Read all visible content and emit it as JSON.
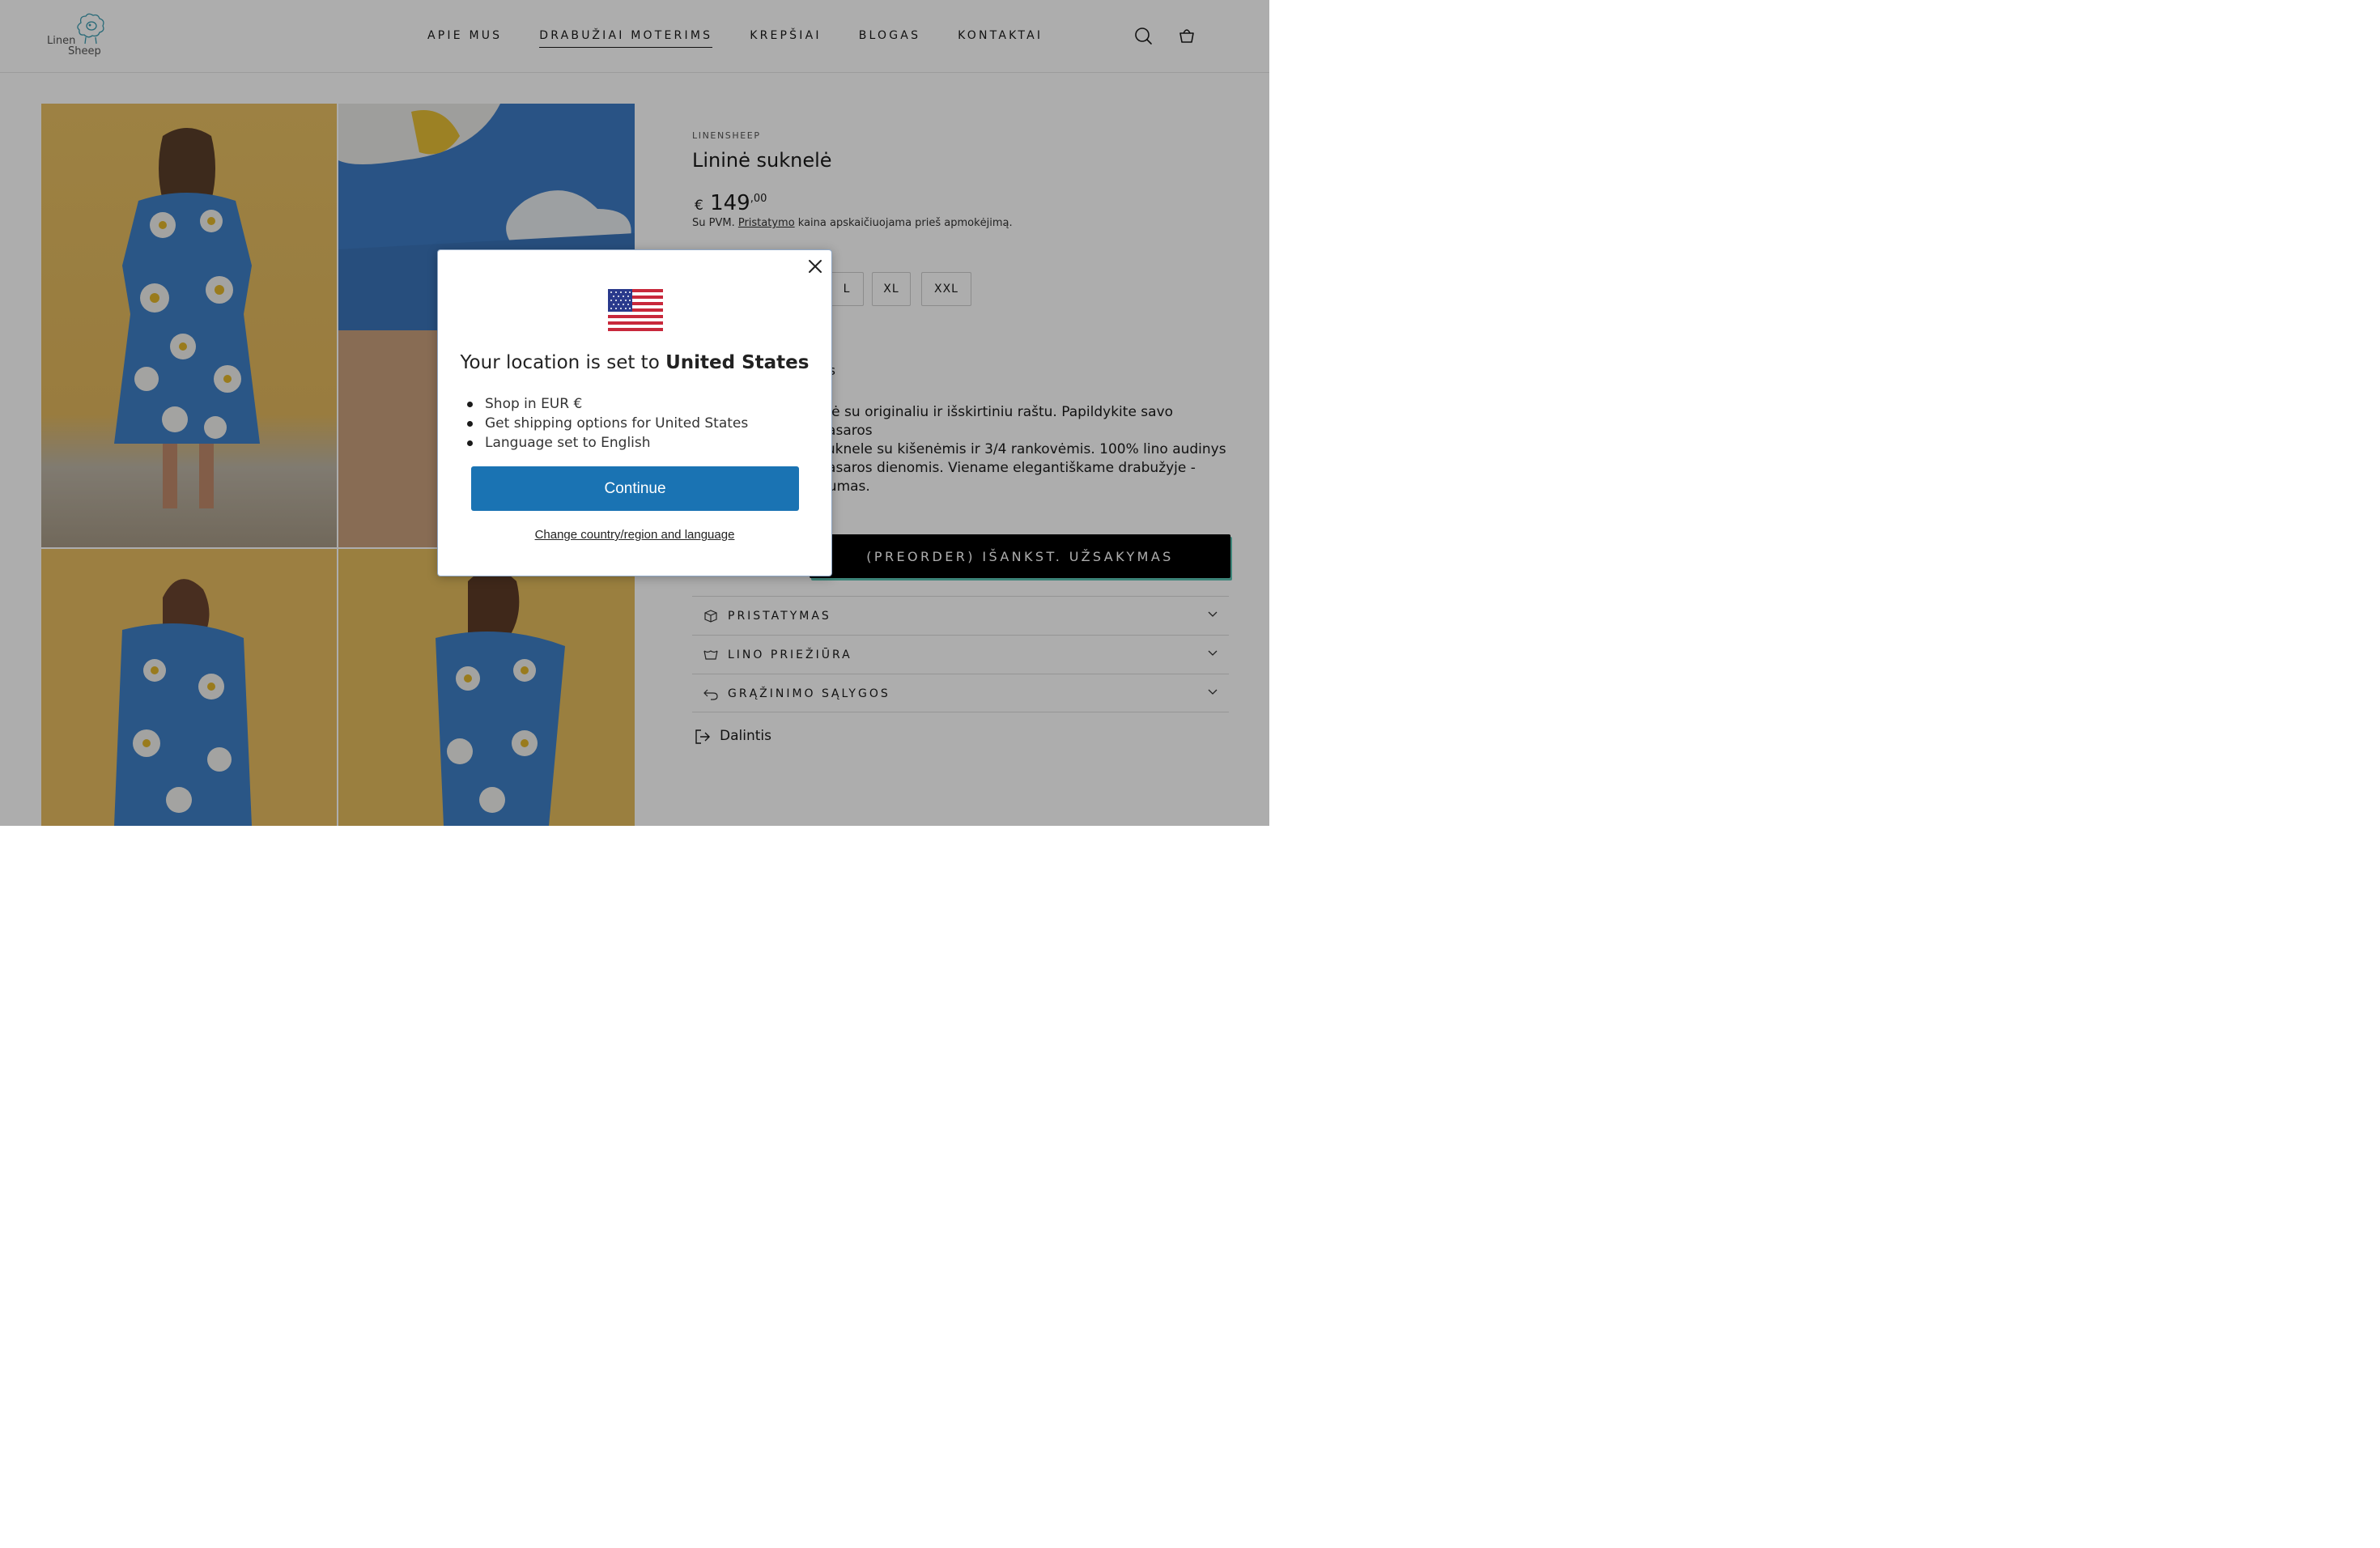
{
  "brand": {
    "logo_text_1": "Linen",
    "logo_text_2": "Sheep"
  },
  "nav": {
    "items": [
      "APIE MUS",
      "DRABUŽIAI MOTERIMS",
      "KREPŠIAI",
      "BLOGAS",
      "KONTAKTAI"
    ],
    "active_index": 1
  },
  "header_icons": [
    "search-icon",
    "shopping-bag-icon"
  ],
  "product": {
    "vendor": "LINENSHEEP",
    "title": "Lininė suknelė",
    "price_currency": "€",
    "price_main": "149",
    "price_cents": ",00",
    "tax_note_prefix": "Su PVM. ",
    "tax_note_link": "Pristatymo",
    "tax_note_suffix": " kaina apskaičiuojama prieš apmokėjimą.",
    "sizes": [
      "L",
      "XL",
      "XXL"
    ],
    "size_guide_fragment": "s-xs",
    "description_lines": [
      "elė su originaliu ir išskirtiniu raštu. Papildykite savo vasaros",
      "suknele su kišenėmis ir 3/4 rankovėmis. 100% lino audinys",
      "vasaros dienomis. Viename elegantiškame drabužyje -",
      "gumas."
    ],
    "preorder_label": "(PREORDER) IŠANKST. UŽSAKYMAS"
  },
  "accordions": [
    {
      "label": "PRISTATYMAS",
      "icon": "box-icon"
    },
    {
      "label": "LINO PRIEŽIŪRA",
      "icon": "wash-icon"
    },
    {
      "label": "GRĄŽINIMO SĄLYGOS",
      "icon": "return-icon"
    }
  ],
  "share": {
    "label": "Dalintis",
    "icon": "share-icon"
  },
  "modal": {
    "flag": "us-flag-icon",
    "title_prefix": "Your location is set to ",
    "title_country": "United States",
    "bullets": [
      "Shop in EUR €",
      "Get shipping options for United States",
      "Language set to English"
    ],
    "continue_label": "Continue",
    "change_label": "Change country/region and language"
  },
  "colors": {
    "primary_button": "#1a73b3",
    "preorder_bg": "#000000",
    "preorder_accent": "#5ec4b4",
    "dress_blue": "#3d7bc4",
    "wall_yellow": "#e6bc60"
  }
}
